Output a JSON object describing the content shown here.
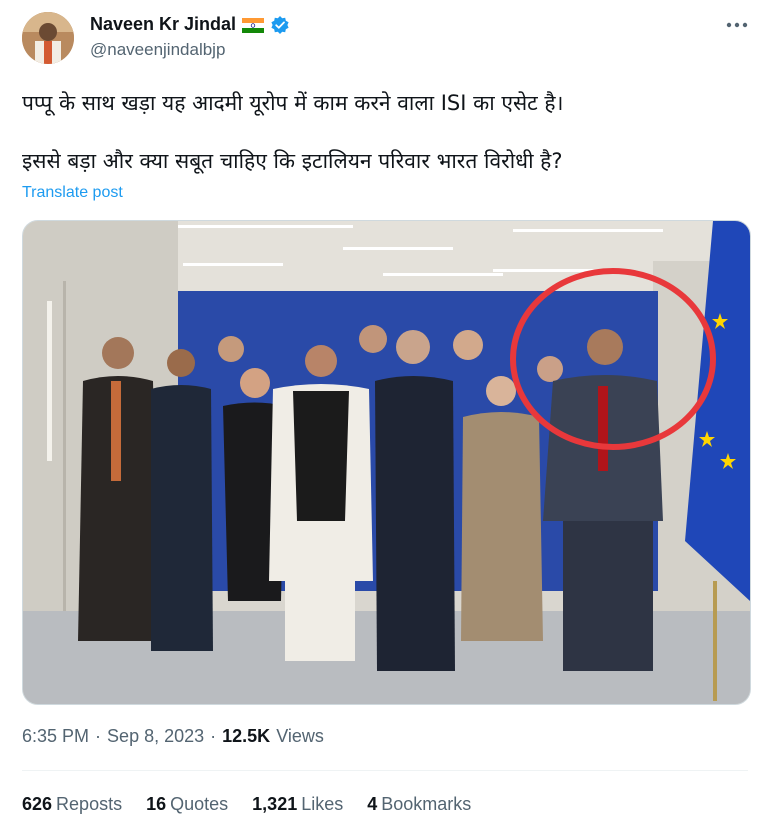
{
  "author": {
    "name": "Naveen Kr Jindal",
    "handle": "@naveenjindalbjp",
    "flag_icon": "india-flag-icon",
    "verified_icon": "verified-badge-icon",
    "verified_color": "#1d9bf0"
  },
  "more_icon": "more-options-icon",
  "tweet": {
    "line1": "पप्पू के साथ खड़ा यह आदमी यूरोप में काम करने वाला ISI का एसेट है।",
    "line2": "इससे बड़ा और क्या सबूत चाहिए कि इटालियन परिवार भारत विरोधी है?",
    "translate_label": "Translate post"
  },
  "media": {
    "kind": "photo",
    "annotation_color": "#e8383b",
    "flag_color": "#1f47b8"
  },
  "meta": {
    "time": "6:35 PM",
    "separator": "·",
    "date": "Sep 8, 2023",
    "views_count": "12.5K",
    "views_label": "Views"
  },
  "stats": {
    "reposts_count": "626",
    "reposts_label": "Reposts",
    "quotes_count": "16",
    "quotes_label": "Quotes",
    "likes_count": "1,321",
    "likes_label": "Likes",
    "bookmarks_count": "4",
    "bookmarks_label": "Bookmarks"
  },
  "colors": {
    "link": "#1d9bf0",
    "secondary": "#536471",
    "primary": "#0f1419"
  }
}
